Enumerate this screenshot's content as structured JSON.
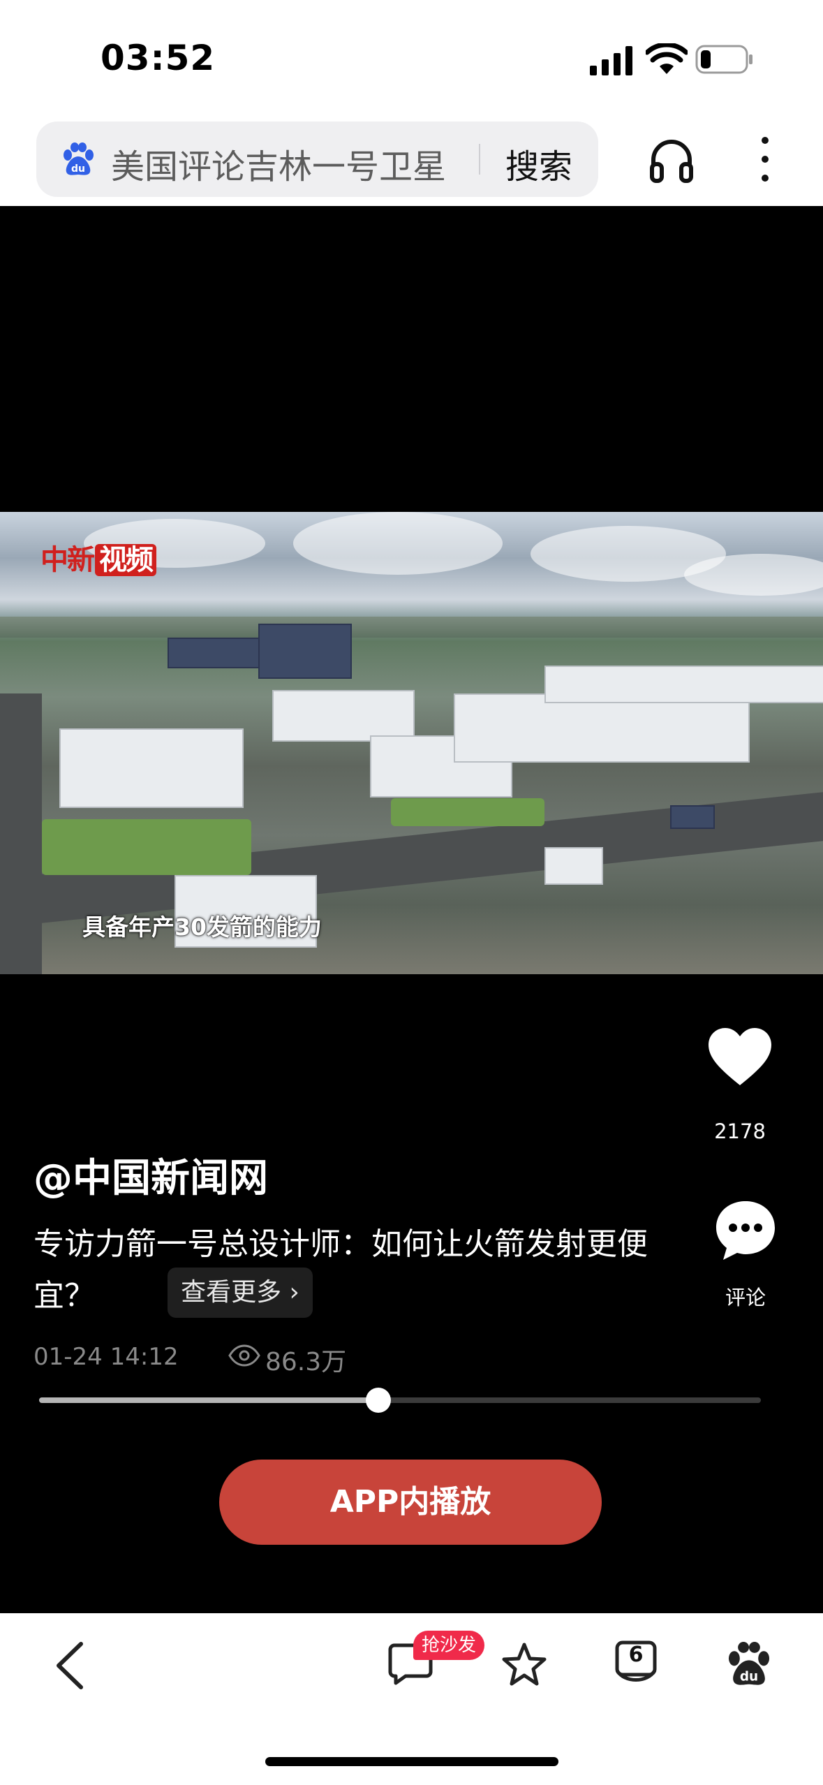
{
  "status_bar": {
    "time": "03:52",
    "icons": [
      "cellular-signal-icon",
      "wifi-icon",
      "battery-icon"
    ]
  },
  "search_bar": {
    "query": "美国评论吉林一号卫星",
    "button_label": "搜索",
    "icons": [
      "baidu-paw-icon",
      "headphone-icon",
      "more-icon"
    ]
  },
  "video": {
    "watermark_text": "中新",
    "watermark_badge": "视频",
    "caption": "具备年产30发箭的能力"
  },
  "actions": {
    "like_count": "2178",
    "comment_label": "评论"
  },
  "info": {
    "author": "@中国新闻网",
    "title": "专访力箭一号总设计师：如何让火箭发射更便宜？",
    "see_more": "查看更多 ›",
    "date": "01-24 14:12",
    "views": "86.3万"
  },
  "player": {
    "progress": 0.47
  },
  "cta": {
    "label": "APP内播放"
  },
  "bottom_bar": {
    "comment_badge": "抢沙发",
    "tabs_count": "6",
    "icons": [
      "back-icon",
      "comment-icon",
      "star-icon",
      "tabs-icon",
      "baidu-paw-icon"
    ]
  },
  "colors": {
    "accent_red": "#c8443a",
    "badge_red": "#f02a4a",
    "video_bg": "#000000"
  }
}
